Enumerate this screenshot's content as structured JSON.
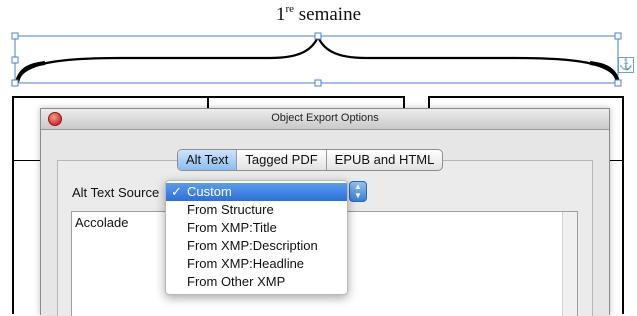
{
  "document": {
    "heading_number": "1",
    "heading_superscript": "re",
    "heading_word": "semaine"
  },
  "dialog": {
    "title": "Object Export Options",
    "tabs": [
      {
        "label": "Alt Text",
        "active": true
      },
      {
        "label": "Tagged PDF",
        "active": false
      },
      {
        "label": "EPUB and HTML",
        "active": false
      }
    ],
    "alt_text_source_label": "Alt Text Source",
    "alt_text_value": "Accolade"
  },
  "dropdown": {
    "selected": "Custom",
    "options": [
      "Custom",
      "From Structure",
      "From XMP:Title",
      "From XMP:Description",
      "From XMP:Headline",
      "From Other XMP"
    ],
    "check_icon": "✓"
  },
  "icons": {
    "anchor": "⚓",
    "popup_arrows": "▲▼"
  },
  "colors": {
    "selection_handles": "#4a7fd4",
    "menu_highlight": "#3b7fe0",
    "tab_active": "#a9cdf5"
  }
}
